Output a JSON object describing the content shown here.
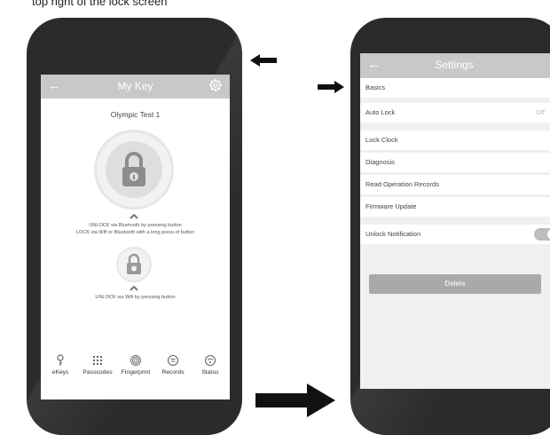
{
  "caption": "top right of the lock screen",
  "left_screen": {
    "title": "My Key",
    "back_icon": "arrow-left-icon",
    "settings_icon": "gear-icon",
    "key_name": "Olympic Test 1",
    "bluetooth_note_line1": "UNLOCK via Bluetooth by pressing button",
    "bluetooth_note_line2": "LOCK via Wifi or Bluetooth with a long press of button",
    "wifi_note": "UNLOCK via Wifi by pressing button",
    "tabs": [
      {
        "label": "eKeys",
        "icon": "key-icon"
      },
      {
        "label": "Passcodes",
        "icon": "keypad-icon"
      },
      {
        "label": "Fingerprint",
        "icon": "fingerprint-icon"
      },
      {
        "label": "Records",
        "icon": "records-icon"
      },
      {
        "label": "Status",
        "icon": "wifi-status-icon"
      }
    ]
  },
  "right_screen": {
    "title": "Settings",
    "back_icon": "arrow-left-icon",
    "rows": [
      {
        "label": "Basics"
      },
      {
        "label": "Auto Lock",
        "value": "Off"
      },
      {
        "label": "Lock Clock"
      },
      {
        "label": "Diagnosis"
      },
      {
        "label": "Read Operation Records"
      },
      {
        "label": "Firmware Update"
      },
      {
        "label": "Unlock Notification",
        "toggle_on": true
      }
    ],
    "delete_label": "Delete"
  },
  "colors": {
    "appbar": "#c8c8c8",
    "phone_body": "#2b2b2b",
    "arrow": "#111111"
  }
}
